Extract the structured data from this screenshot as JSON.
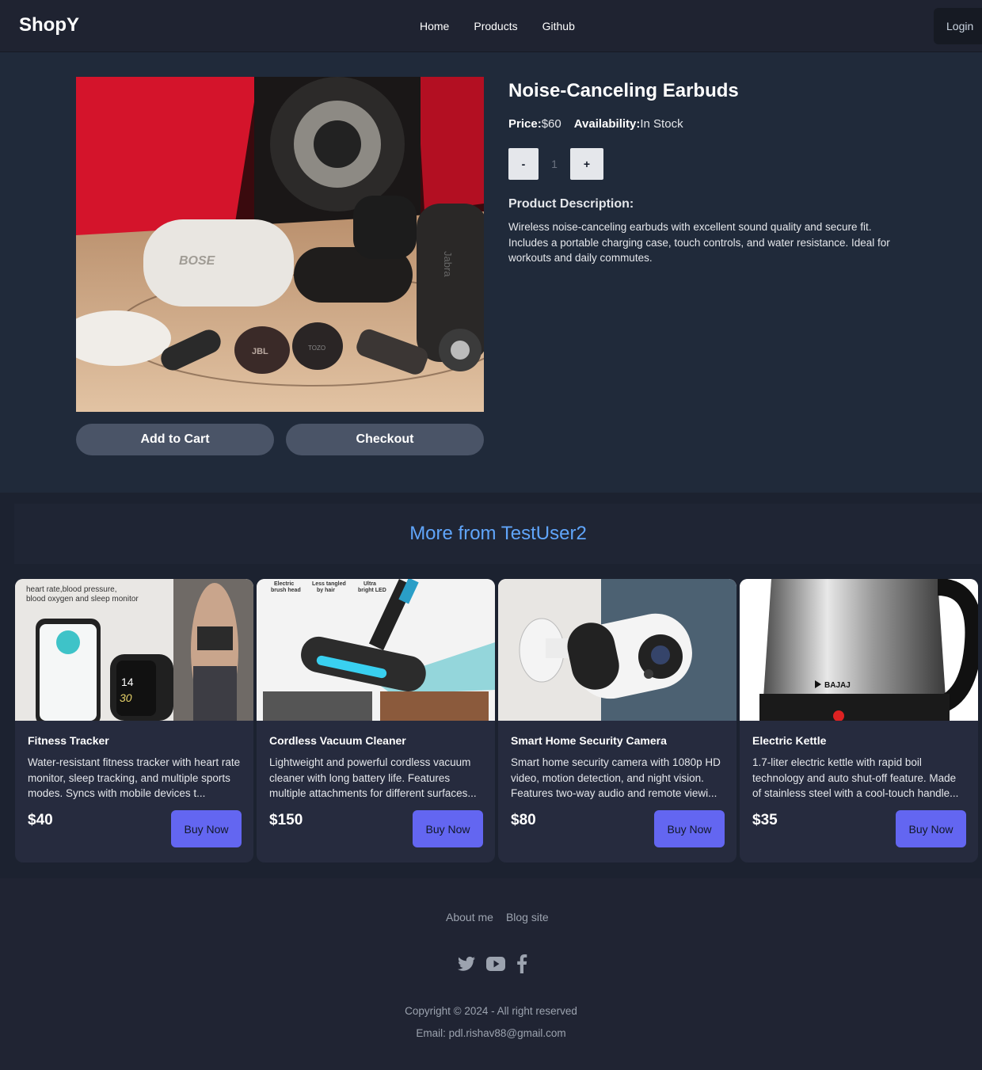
{
  "header": {
    "brand": "ShopY",
    "nav": [
      "Home",
      "Products",
      "Github"
    ],
    "login": "Login"
  },
  "product": {
    "title": "Noise-Canceling Earbuds",
    "price_label": "Price:",
    "price": "$60",
    "availability_label": "Availability:",
    "availability": "In Stock",
    "qty_minus": "-",
    "qty_value": "1",
    "qty_plus": "+",
    "desc_heading": "Product Description:",
    "description": "Wireless noise-canceling earbuds with excellent sound quality and secure fit. Includes a portable charging case, touch controls, and water resistance. Ideal for workouts and daily commutes.",
    "add_to_cart": "Add to Cart",
    "checkout": "Checkout",
    "image_text": {
      "case_brand": "BOSE",
      "side_brand": "Jabra",
      "jbl": "JBL",
      "tozo": "TOZO"
    }
  },
  "more": {
    "heading": "More from TestUser2",
    "cards": [
      {
        "title": "Fitness Tracker",
        "description": "Water-resistant fitness tracker with heart rate monitor, sleep tracking, and multiple sports modes. Syncs with mobile devices t...",
        "price": "$40",
        "button": "Buy Now",
        "image_text": {
          "caption_1": "heart rate,blood pressure,",
          "caption_2": "blood oxygen and sleep monitor",
          "watch_1": "14",
          "watch_2": "30"
        }
      },
      {
        "title": "Cordless Vacuum Cleaner",
        "description": "Lightweight and powerful cordless vacuum cleaner with long battery life. Features multiple attachments for different surfaces...",
        "price": "$150",
        "button": "Buy Now",
        "image_text": {
          "label_1a": "Electric",
          "label_1b": "brush head",
          "label_2a": "Less tangled",
          "label_2b": "by hair",
          "label_3a": "Ultra",
          "label_3b": "bright LED"
        }
      },
      {
        "title": "Smart Home Security Camera",
        "description": "Smart home security camera with 1080p HD video, motion detection, and night vision. Features two-way audio and remote viewi...",
        "price": "$80",
        "button": "Buy Now"
      },
      {
        "title": "Electric Kettle",
        "description": "1.7-liter electric kettle with rapid boil technology and auto shut-off feature. Made of stainless steel with a cool-touch handle...",
        "price": "$35",
        "button": "Buy Now",
        "image_text": {
          "brand": "BAJAJ"
        }
      }
    ]
  },
  "footer": {
    "links": [
      "About me",
      "Blog site"
    ],
    "socials": [
      "twitter-icon",
      "youtube-icon",
      "facebook-icon"
    ],
    "copyright": "Copyright © 2024 - All right reserved",
    "email": "Email: pdl.rishav88@gmail.com"
  },
  "colors": {
    "accent_heading": "#60a5fa",
    "buy_button": "#6366f1"
  }
}
